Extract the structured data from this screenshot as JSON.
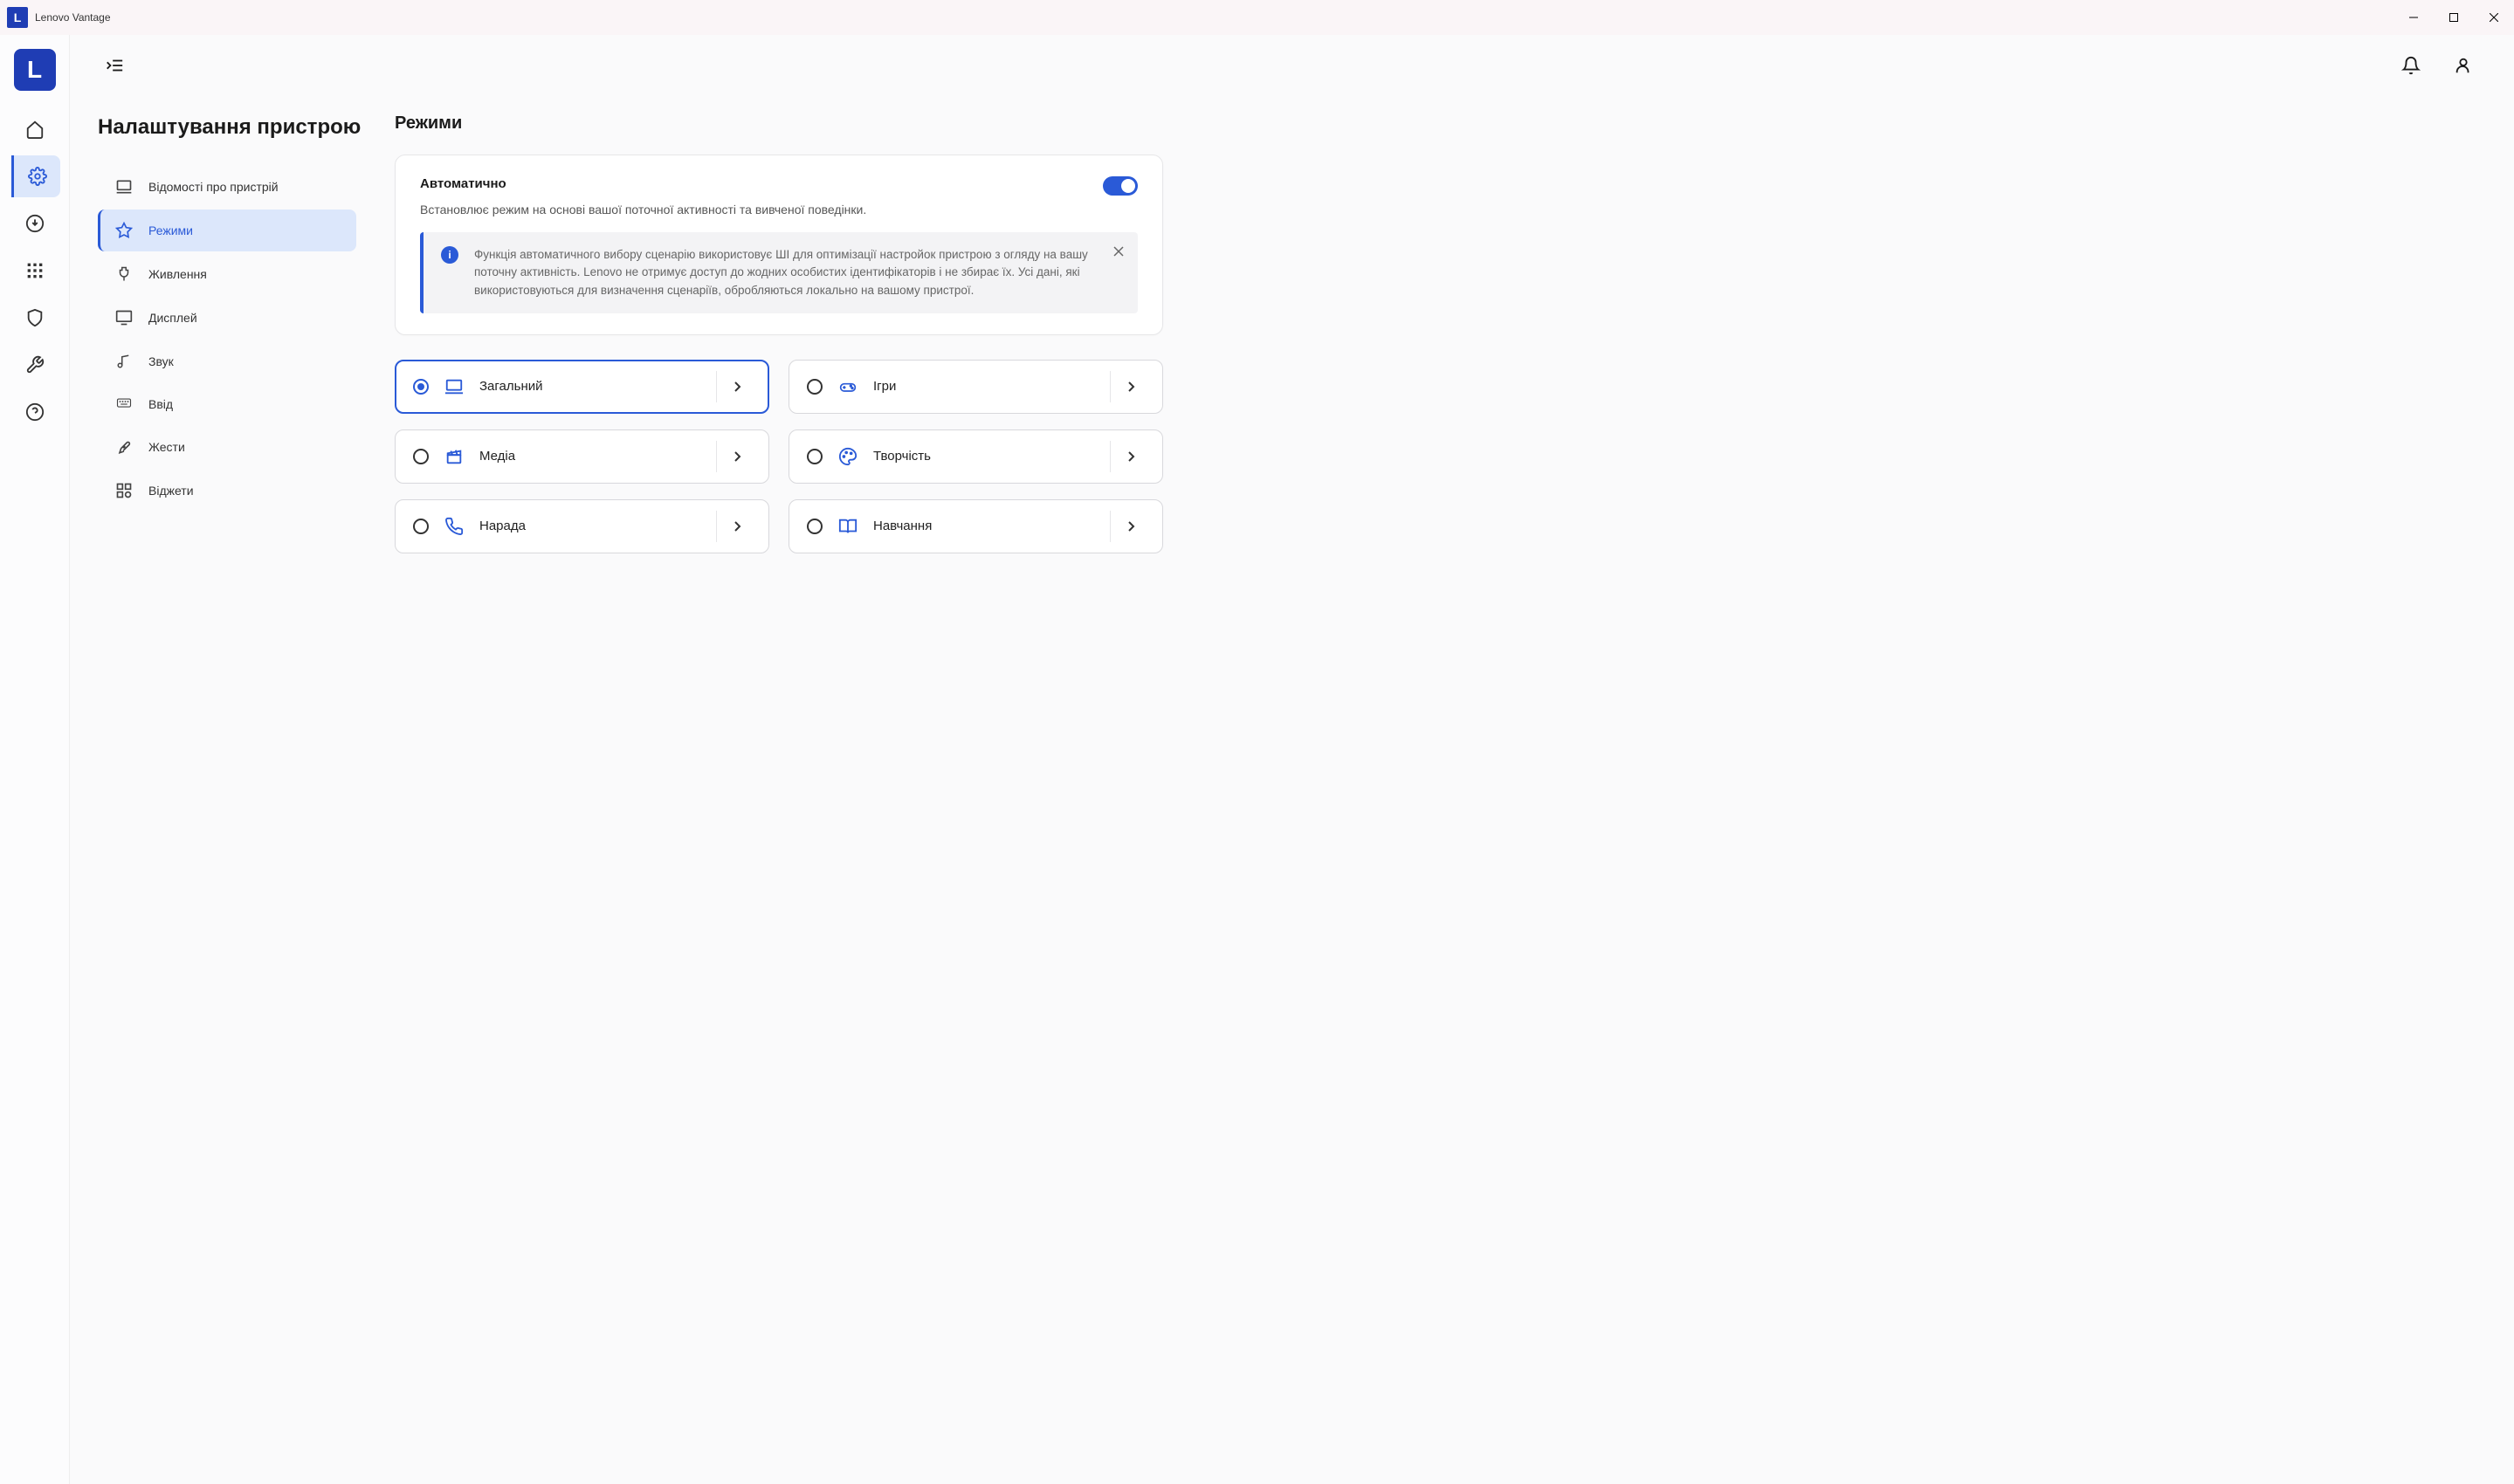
{
  "window": {
    "title": "Lenovo Vantage"
  },
  "page": {
    "title": "Налаштування пристрою"
  },
  "subnav": {
    "items": [
      {
        "label": "Відомості про пристрій"
      },
      {
        "label": "Режими"
      },
      {
        "label": "Живлення"
      },
      {
        "label": "Дисплей"
      },
      {
        "label": "Звук"
      },
      {
        "label": "Ввід"
      },
      {
        "label": "Жести"
      },
      {
        "label": "Віджети"
      }
    ],
    "active_index": 1
  },
  "main": {
    "section_title": "Режими",
    "auto": {
      "title": "Автоматично",
      "desc": "Встановлює режим на основі вашої поточної активності та вивченої поведінки.",
      "enabled": true
    },
    "banner": {
      "text": "Функція автоматичного вибору сценарію використовує ШІ для оптимізації настройок пристрою з огляду на вашу поточну активність. Lenovo не отримує доступ до жодних особистих ідентифікаторів і не збирає їх. Усі дані, які використовуються для визначення сценаріїв, обробляються локально на вашому пристрої."
    },
    "modes": [
      {
        "label": "Загальний",
        "icon": "laptop",
        "selected": true
      },
      {
        "label": "Ігри",
        "icon": "gamepad",
        "selected": false
      },
      {
        "label": "Медіа",
        "icon": "clapper",
        "selected": false
      },
      {
        "label": "Творчість",
        "icon": "palette",
        "selected": false
      },
      {
        "label": "Нарада",
        "icon": "phone",
        "selected": false
      },
      {
        "label": "Навчання",
        "icon": "book",
        "selected": false
      }
    ]
  }
}
